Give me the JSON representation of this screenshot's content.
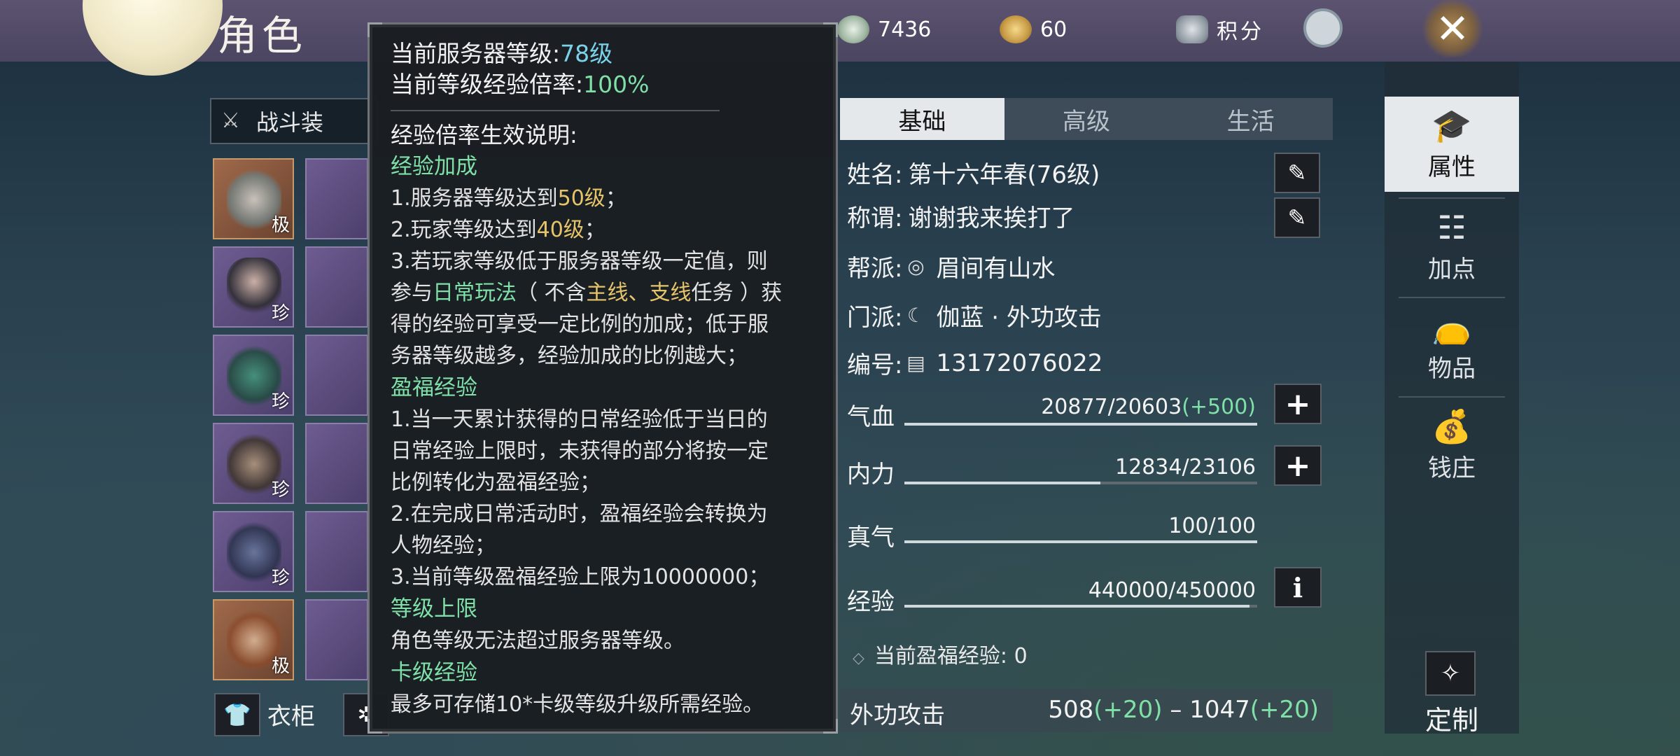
{
  "header": {
    "title": "角色",
    "resources": [
      {
        "icon": "jade-icon",
        "value": "7436"
      },
      {
        "icon": "coin-bag-icon",
        "value": "60"
      },
      {
        "icon": "points-shield-icon",
        "value": "积分"
      }
    ]
  },
  "equipment": {
    "outfit_select": "战斗装",
    "slots_quality": [
      "极",
      "珍",
      "珍",
      "珍",
      "珍",
      "极"
    ],
    "wardrobe_label": "衣柜"
  },
  "tooltip": {
    "server_level_label": "当前服务器等级:",
    "server_level_value": "78级",
    "exp_rate_label": "当前等级经验倍率:",
    "exp_rate_value": "100%",
    "section_title": "经验倍率生效说明:",
    "bonus_head": "经验加成",
    "bonus_1a": "1.服务器等级达到",
    "bonus_1b": "50级",
    "bonus_1c": "；",
    "bonus_2a": "2.玩家等级达到",
    "bonus_2b": "40级",
    "bonus_2c": "；",
    "bonus_3_line1": "3.若玩家等级低于服务器等级一定值，则",
    "bonus_3_l2a": "参与",
    "bonus_3_l2b": "日常玩法",
    "bonus_3_l2c": "（ 不含",
    "bonus_3_l2d": "主线",
    "bonus_3_l2e": "、",
    "bonus_3_l2f": "支线",
    "bonus_3_l2g": "任务 ）获",
    "bonus_3_line3": "得的经验可享受一定比例的加成；低于服",
    "bonus_3_line4": "务器等级越多，经验加成的比例越大；",
    "bless_head": "盈福经验",
    "bless_1_line1": "1.当一天累计获得的日常经验低于当日的",
    "bless_1_line2": "日常经验上限时，未获得的部分将按一定",
    "bless_1_line3": "比例转化为盈福经验；",
    "bless_2_line1": "2.在完成日常活动时，盈福经验会转换为",
    "bless_2_line2": "人物经验；",
    "bless_3_line1": "3.当前等级盈福经验上限为10000000；",
    "cap_head": "等级上限",
    "cap_line": "角色等级无法超过服务器等级。",
    "card_head": "卡级经验",
    "card_line": "最多可存储10*卡级等级升级所需经验。"
  },
  "tabs": [
    "基础",
    "高级",
    "生活"
  ],
  "profile": {
    "name_label": "姓名:",
    "name_value": "第十六年春(76级)",
    "title_label": "称谓:",
    "title_value": "谢谢我来挨打了",
    "guild_label": "帮派:",
    "guild_value": "眉间有山水",
    "sect_label": "门派:",
    "sect_value": "伽蓝 · 外功攻击",
    "id_label": "编号:",
    "id_value": "13172076022"
  },
  "stats": {
    "hp_label": "气血",
    "hp_current": "20877",
    "hp_max": "/20603",
    "hp_bonus": "(+500)",
    "hp_fill": 1.0,
    "mp_label": "内力",
    "mp_current": "12834",
    "mp_max": "/23106",
    "mp_fill": 0.555,
    "qi_label": "真气",
    "qi_current": "100",
    "qi_max": "/100",
    "qi_fill": 1.0,
    "exp_label": "经验",
    "exp_current": "440000",
    "exp_max": "/450000",
    "exp_fill": 0.978,
    "bless_label": "当前盈福经验",
    "bless_value": ": 0",
    "attack_label": "外功攻击",
    "attack_min": "508",
    "attack_min_bonus": "(+20)",
    "attack_sep": " – ",
    "attack_max": "1047",
    "attack_max_bonus": "(+20)"
  },
  "sidenav": {
    "items": [
      "属性",
      "加点",
      "物品",
      "钱庄"
    ],
    "custom_label": "定制"
  },
  "colors": {
    "accent_green": "#7fe0a8",
    "accent_cyan": "#7ad2e9",
    "accent_gold": "#e6c46a"
  }
}
